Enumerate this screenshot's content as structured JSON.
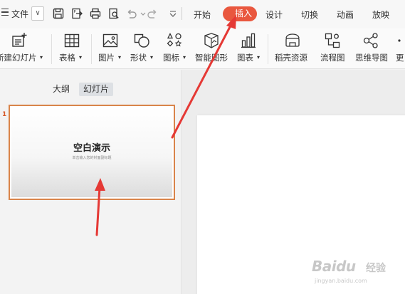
{
  "menubar": {
    "file_label": "文件",
    "file_dropdown_glyph": "∨",
    "quick_icons": [
      "save-icon",
      "export-icon",
      "print-icon",
      "print-preview-icon",
      "undo-icon",
      "redo-icon",
      "customize-icon"
    ],
    "tabs": [
      {
        "label": "开始",
        "active": false
      },
      {
        "label": "插入",
        "active": true
      },
      {
        "label": "设计",
        "active": false
      },
      {
        "label": "切换",
        "active": false
      },
      {
        "label": "动画",
        "active": false
      },
      {
        "label": "放映",
        "active": false
      }
    ]
  },
  "ribbon": {
    "items": [
      {
        "label": "新建幻灯片",
        "icon": "new-slide-icon",
        "dropdown": true
      },
      {
        "label": "表格",
        "icon": "table-icon",
        "dropdown": true
      },
      {
        "label": "图片",
        "icon": "picture-icon",
        "dropdown": true
      },
      {
        "label": "形状",
        "icon": "shape-icon",
        "dropdown": true
      },
      {
        "label": "图标",
        "icon": "icons-icon",
        "dropdown": true
      },
      {
        "label": "智能图形",
        "icon": "smart-graphic-icon",
        "dropdown": false
      },
      {
        "label": "图表",
        "icon": "chart-icon",
        "dropdown": true
      },
      {
        "label": "稻壳资源",
        "icon": "docer-resource-icon",
        "dropdown": false
      },
      {
        "label": "流程图",
        "icon": "flowchart-icon",
        "dropdown": false
      },
      {
        "label": "思维导图",
        "icon": "mindmap-icon",
        "dropdown": false
      },
      {
        "label": "更",
        "icon": "more-icon",
        "dropdown": false
      }
    ]
  },
  "left_panel": {
    "tabs": [
      {
        "label": "大纲",
        "active": false
      },
      {
        "label": "幻灯片",
        "active": true
      }
    ],
    "slides": [
      {
        "number": "1",
        "title": "空白演示",
        "subtitle": "单击输入您的封面副标题"
      }
    ]
  },
  "colors": {
    "accent": "#e9573e",
    "thumb_border": "#d9844a",
    "arrow": "#e53935"
  },
  "watermark": {
    "logo_text": "Baidu",
    "logo_cn": "经验",
    "url": "jingyan.baidu.com"
  }
}
